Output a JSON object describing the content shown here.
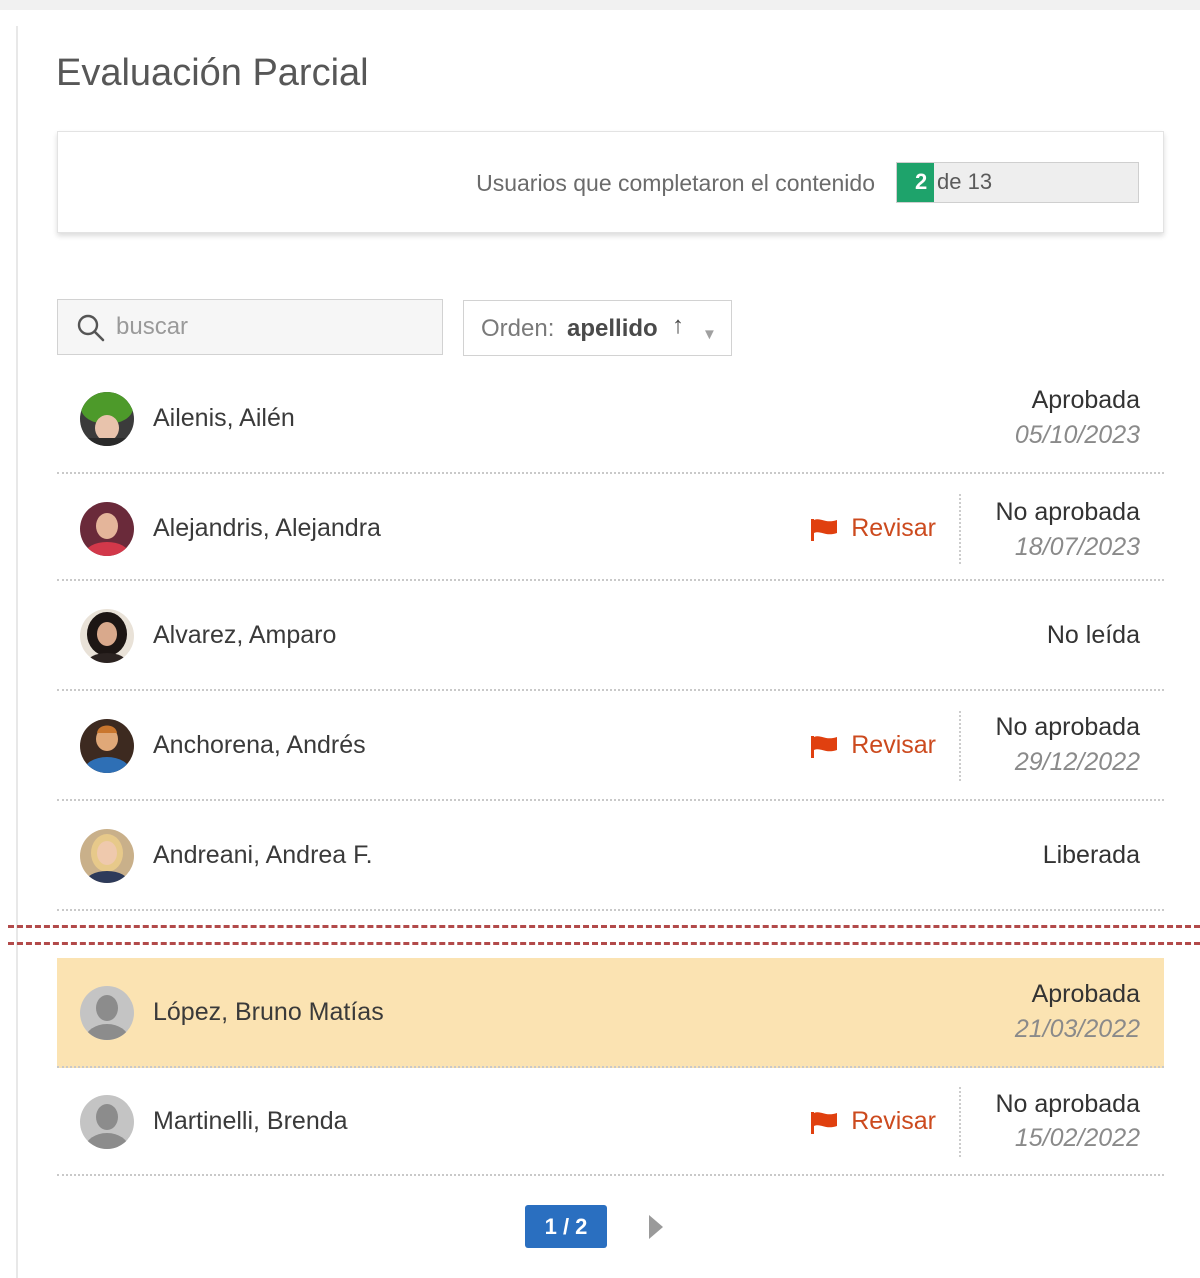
{
  "page": {
    "title": "Evaluación Parcial"
  },
  "progress": {
    "label": "Usuarios que completaron el contenido",
    "completed": "2",
    "total_text": "de 13",
    "fraction": 0.1538,
    "fill_color": "#1ea36b"
  },
  "search": {
    "placeholder": "buscar",
    "value": "",
    "icon": "search-icon"
  },
  "order": {
    "label": "Orden:",
    "value": "apellido",
    "direction": "↑",
    "caret": "▼"
  },
  "users": [
    {
      "name": "Ailenis, Ailén",
      "status": "Aprobada",
      "date": "05/10/2023",
      "review": "",
      "avatar": "photo-green-hat"
    },
    {
      "name": "Alejandris, Alejandra",
      "status": "No aprobada",
      "date": "18/07/2023",
      "review": "Revisar",
      "avatar": "photo-dark-hair-red-top"
    },
    {
      "name": "Alvarez, Amparo",
      "status": "No leída",
      "date": "",
      "review": "",
      "avatar": "photo-curly-hair"
    },
    {
      "name": "Anchorena, Andrés",
      "status": "No aprobada",
      "date": "29/12/2022",
      "review": "Revisar",
      "avatar": "photo-blue-shirt"
    },
    {
      "name": "Andreani, Andrea F.",
      "status": "Liberada",
      "date": "",
      "review": "",
      "avatar": "photo-blonde"
    },
    {
      "name": "López, Bruno Matías",
      "status": "Aprobada",
      "date": "21/03/2022",
      "review": "",
      "avatar": "placeholder-avatar",
      "highlighted": true
    },
    {
      "name": "Martinelli, Brenda",
      "status": "No aprobada",
      "date": "15/02/2022",
      "review": "Revisar",
      "avatar": "placeholder-avatar"
    }
  ],
  "pagination": {
    "current": "1 / 2",
    "next_icon": "chevron-right-icon"
  },
  "colors": {
    "accent_blue": "#2a6fc0",
    "review_red": "#cc4a1e",
    "highlight": "#fbe3b2",
    "progress_green": "#1ea36b"
  }
}
